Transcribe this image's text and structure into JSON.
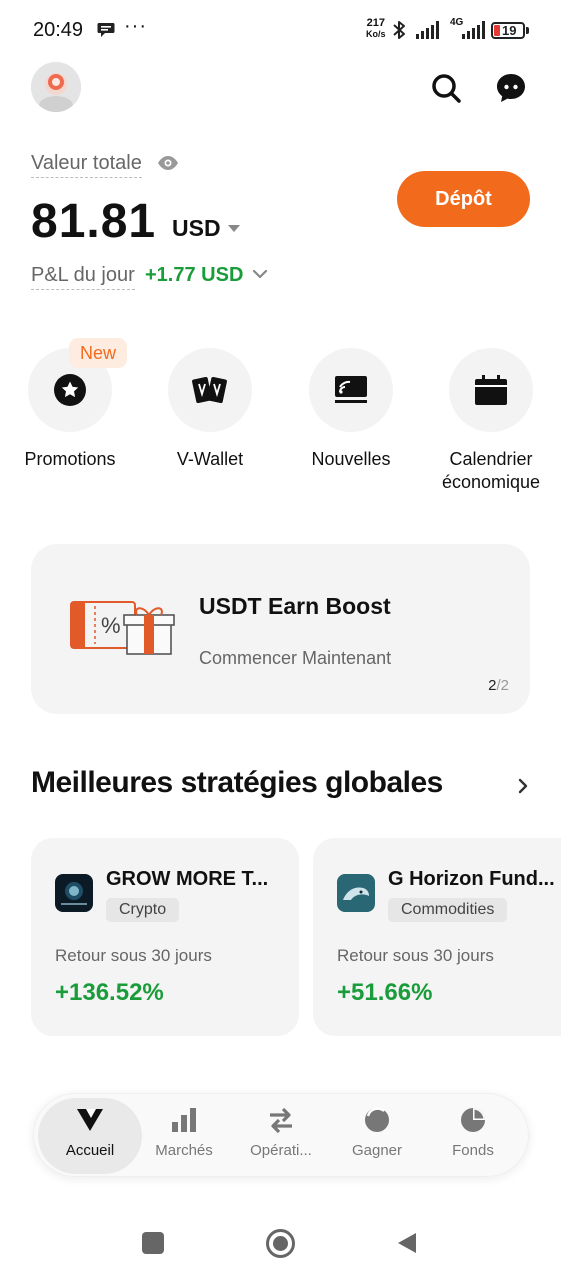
{
  "status_bar": {
    "time": "20:49",
    "dots": "···",
    "speed_value": "217",
    "speed_unit": "Ko/s",
    "network": "4G",
    "battery": "19"
  },
  "header": {
    "avatar": "avatar",
    "icons": [
      "search-icon",
      "chat-icon"
    ]
  },
  "balance": {
    "label": "Valeur totale",
    "value": "81.81",
    "currency": "USD",
    "deposit_label": "Dépôt",
    "pnl_label": "P&L du jour",
    "pnl_value": "+1.77 USD"
  },
  "shortcuts": [
    {
      "label": "Promotions",
      "badge": "New",
      "icon": "star-icon"
    },
    {
      "label": "V-Wallet",
      "icon": "wallet-cards-icon"
    },
    {
      "label": "Nouvelles",
      "icon": "news-icon"
    },
    {
      "label": "Calendrier économique",
      "icon": "calendar-icon"
    }
  ],
  "promo": {
    "title": "USDT Earn Boost",
    "subtitle": "Commencer Maintenant",
    "pager_current": "2",
    "pager_total": "/2"
  },
  "strategies": {
    "title": "Meilleures stratégies globales",
    "items": [
      {
        "name": "GROW MORE T...",
        "tag": "Crypto",
        "return_label": "Retour sous 30 jours",
        "return_value": "+136.52%"
      },
      {
        "name": "G Horizon Fund...",
        "tag": "Commodities",
        "return_label": "Retour sous 30 jours",
        "return_value": "+51.66%"
      }
    ]
  },
  "bottom_nav": [
    {
      "label": "Accueil",
      "active": true
    },
    {
      "label": "Marchés"
    },
    {
      "label": "Opérati..."
    },
    {
      "label": "Gagner"
    },
    {
      "label": "Fonds"
    }
  ],
  "colors": {
    "accent": "#f26b1d",
    "positive": "#1a9c3a"
  }
}
